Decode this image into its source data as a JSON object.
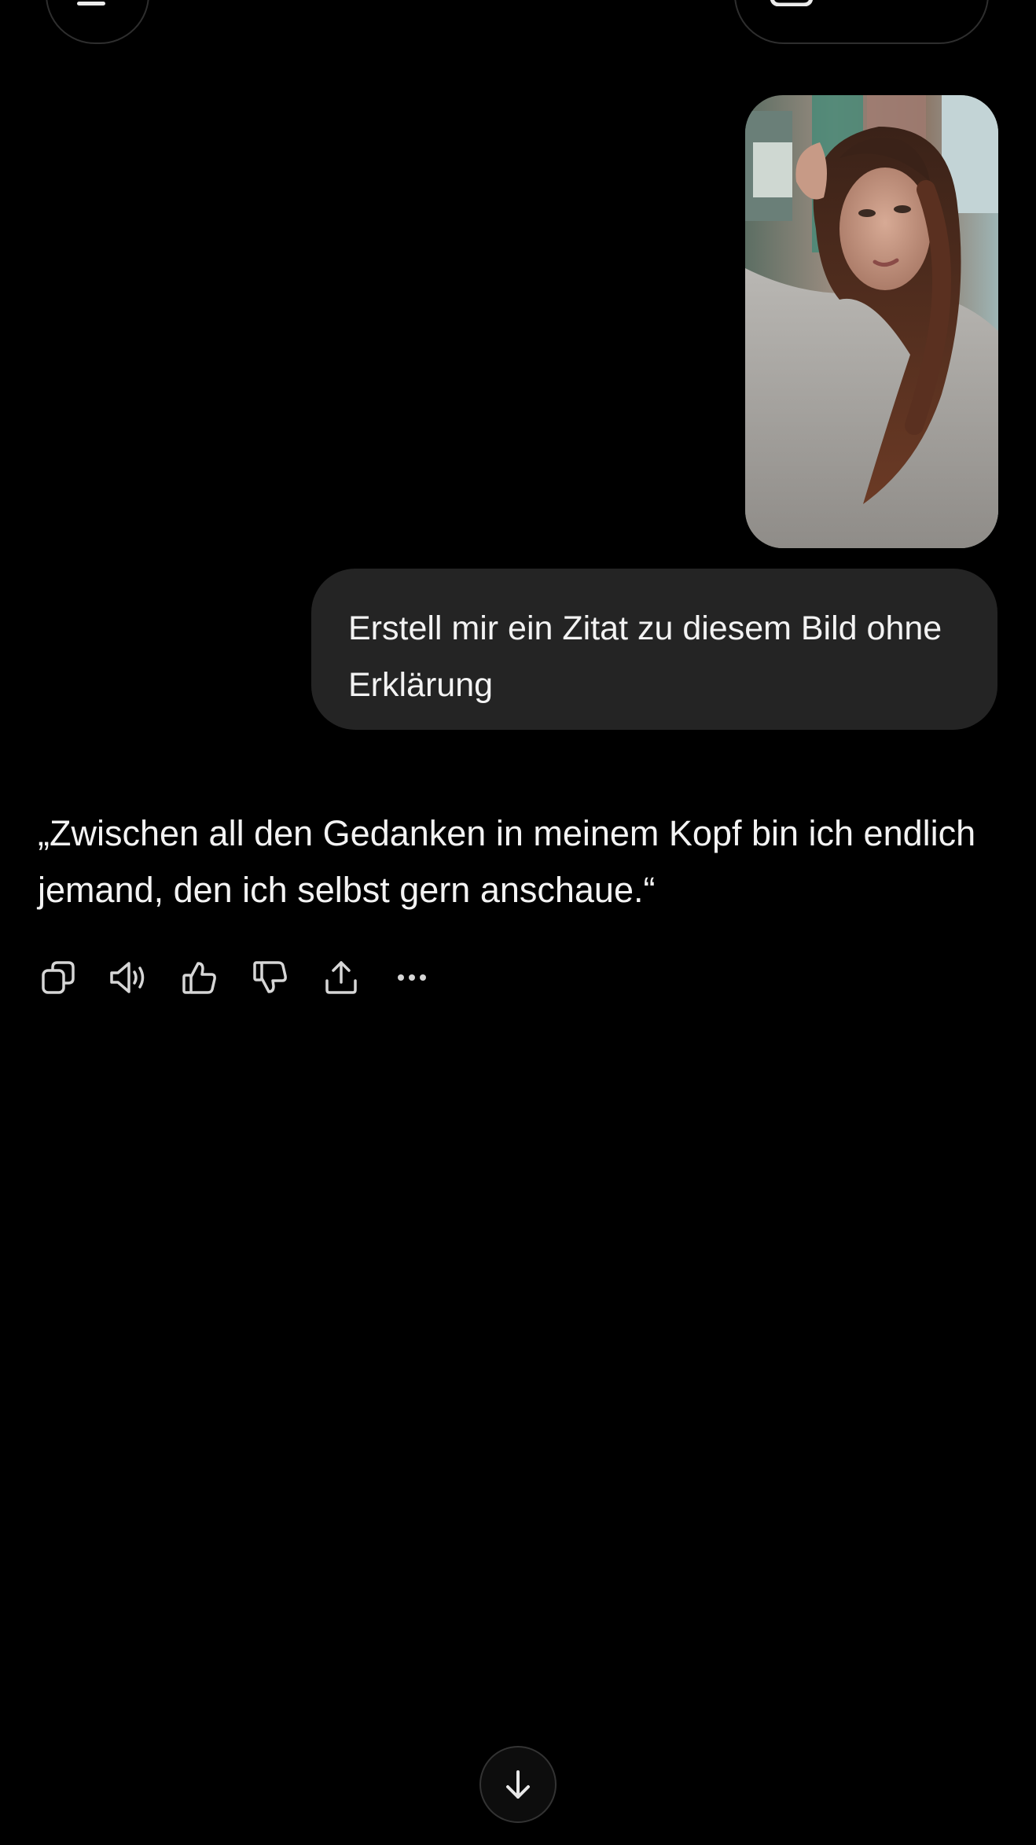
{
  "header": {
    "menu_icon": "menu-icon",
    "right_pill_icon": "new-chat-icon"
  },
  "conversation": {
    "user_image": {
      "icon": "photo-thumbnail"
    },
    "user_message": "Erstell mir ein Zitat zu diesem Bild ohne Erklärung",
    "assistant_message": "„Zwischen all den Gedanken in meinem Kopf bin ich endlich jemand, den ich selbst gern anschaue.“",
    "actions": [
      {
        "name": "copy-icon"
      },
      {
        "name": "read-aloud-icon"
      },
      {
        "name": "thumbs-up-icon"
      },
      {
        "name": "thumbs-down-icon"
      },
      {
        "name": "share-icon"
      },
      {
        "name": "more-icon"
      }
    ]
  },
  "scroll_down": {
    "icon": "arrow-down-icon"
  },
  "colors": {
    "background": "#000000",
    "bubble": "#242424",
    "text": "#f3f3f3",
    "icon": "#d6d6d6"
  }
}
